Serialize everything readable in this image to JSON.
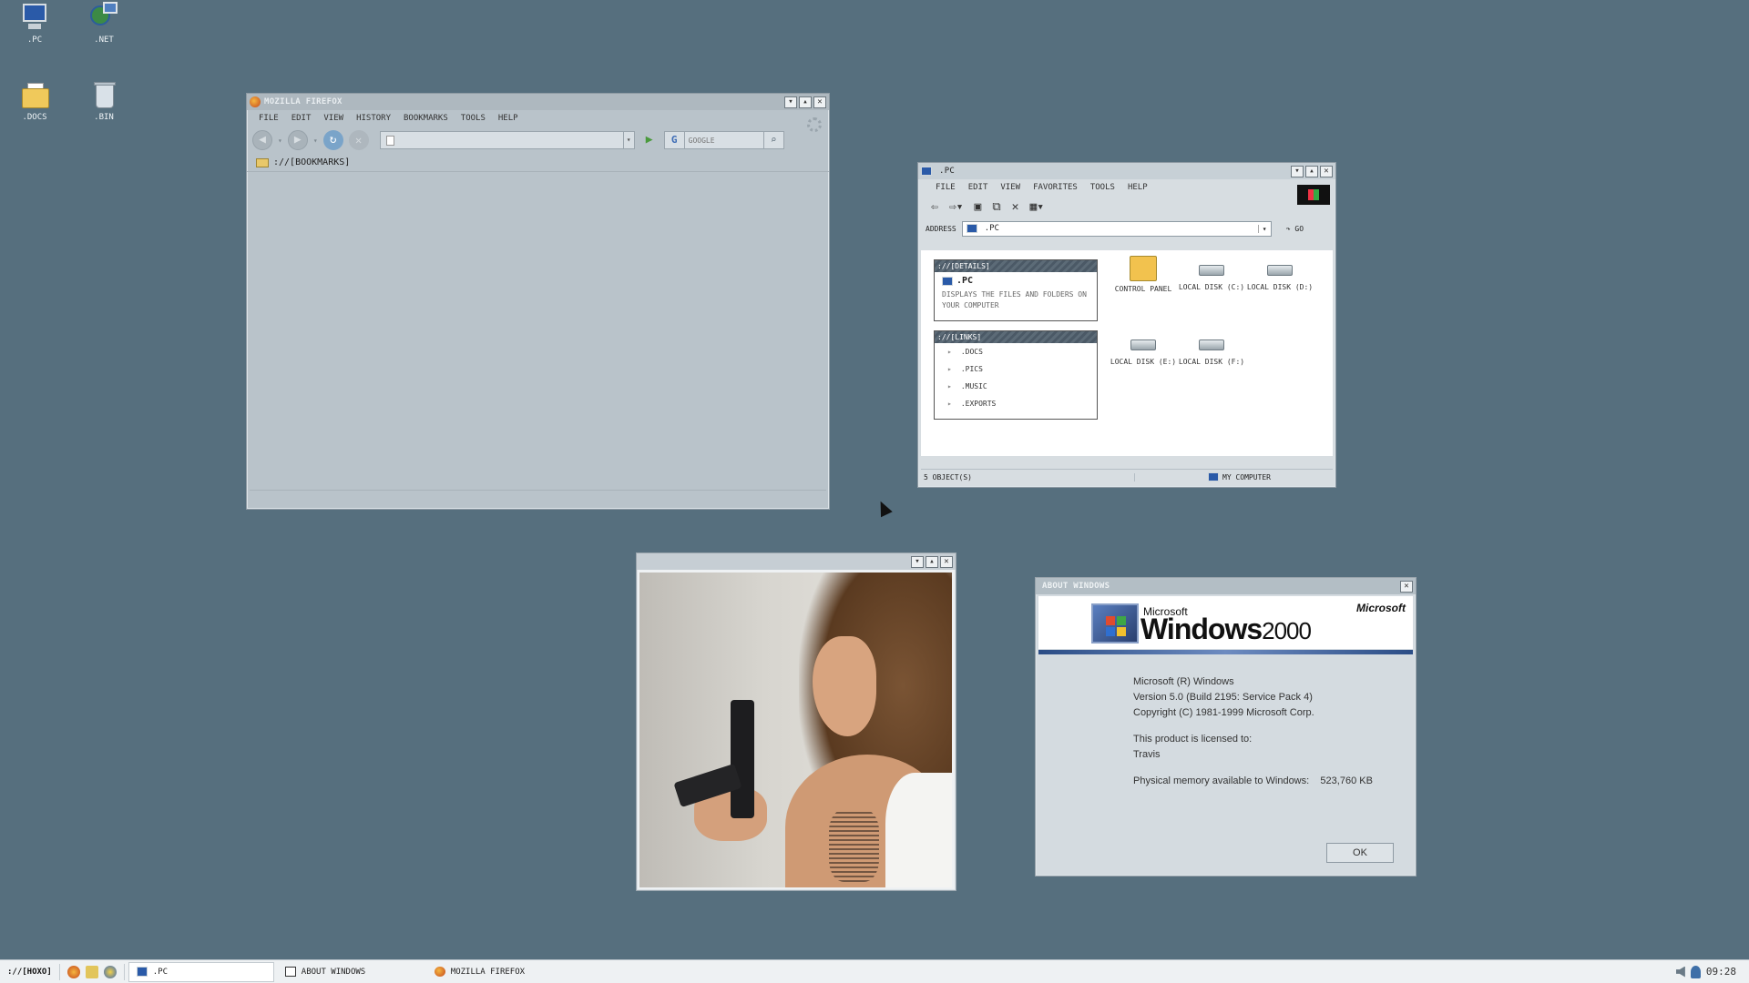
{
  "desktop": {
    "icons": [
      {
        "label": ".PC",
        "icon": "computer-icon"
      },
      {
        "label": ".NET",
        "icon": "network-icon"
      },
      {
        "label": ".DOCS",
        "icon": "folder-icon"
      },
      {
        "label": ".BIN",
        "icon": "recycle-bin-icon"
      }
    ]
  },
  "firefox": {
    "title": "MOZILLA FIREFOX",
    "menu": [
      "FILE",
      "EDIT",
      "VIEW",
      "HISTORY",
      "BOOKMARKS",
      "TOOLS",
      "HELP"
    ],
    "url_value": "",
    "search_placeholder": "GOOGLE",
    "bookmarks_folder": "://[BOOKMARKS]"
  },
  "explorer": {
    "title": ".PC",
    "menu": [
      "FILE",
      "EDIT",
      "VIEW",
      "FAVORITES",
      "TOOLS",
      "HELP"
    ],
    "address_label": "ADDRESS",
    "address_value": ".PC",
    "go_label": "GO",
    "details": {
      "header": "://[DETAILS]",
      "name": ".PC",
      "description": "DISPLAYS THE FILES AND FOLDERS ON YOUR COMPUTER"
    },
    "links": {
      "header": "://[LINKS]",
      "items": [
        ".DOCS",
        ".PICS",
        ".MUSIC",
        ".EXPORTS"
      ]
    },
    "items": [
      {
        "label": "CONTROL PANEL",
        "icon": "control-panel-icon"
      },
      {
        "label": "LOCAL DISK (C:)",
        "icon": "hard-disk-icon"
      },
      {
        "label": "LOCAL DISK (D:)",
        "icon": "hard-disk-icon"
      },
      {
        "label": "LOCAL DISK (E:)",
        "icon": "hard-disk-icon"
      },
      {
        "label": "LOCAL DISK (F:)",
        "icon": "hard-disk-icon"
      }
    ],
    "status_count": "5 OBJECT(S)",
    "status_location": "MY COMPUTER"
  },
  "about": {
    "title": "ABOUT WINDOWS",
    "microsoft_brand": "Microsoft",
    "logo_microsoft": "Microsoft",
    "logo_windows": "Windows",
    "logo_year": "2000",
    "line1": "Microsoft (R) Windows",
    "line2": "Version 5.0 (Build 2195: Service Pack 4)",
    "line3": "Copyright (C) 1981-1999 Microsoft Corp.",
    "licensed_label": "This product is licensed to:",
    "licensed_user": "Travis",
    "memory_label": "Physical memory available to Windows:",
    "memory_value": "523,760 KB",
    "ok_label": "OK"
  },
  "taskbar": {
    "start_label": "://[HOXO]",
    "tasks": [
      ".PC",
      "ABOUT WINDOWS",
      "MOZILLA FIREFOX"
    ],
    "clock": "09:28"
  },
  "colors": {
    "desktop": "#566f7e",
    "window_face": "#c5cdd3",
    "panel_header": "#4b5966"
  }
}
